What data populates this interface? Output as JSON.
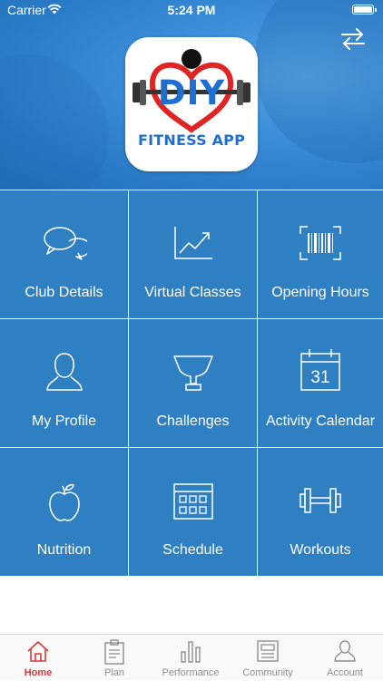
{
  "status_bar": {
    "carrier": "Carrier",
    "time": "5:24 PM"
  },
  "logo": {
    "title": "DIY",
    "subtitle": "FITNESS APP"
  },
  "colors": {
    "tile": "#2f7fc3",
    "active_tab": "#d63a3a",
    "inactive_tab": "#8e8e93",
    "header": "#3d8fd9"
  },
  "tiles": [
    {
      "label": "Club Details",
      "icon": "chat-bubbles-icon"
    },
    {
      "label": "Virtual Classes",
      "icon": "trend-chart-icon"
    },
    {
      "label": "Opening Hours",
      "icon": "barcode-scan-icon"
    },
    {
      "label": "My Profile",
      "icon": "person-icon"
    },
    {
      "label": "Challenges",
      "icon": "trophy-icon"
    },
    {
      "label": "Activity Calendar",
      "icon": "calendar-icon",
      "calendar_day": "31"
    },
    {
      "label": "Nutrition",
      "icon": "apple-icon"
    },
    {
      "label": "Schedule",
      "icon": "schedule-grid-icon"
    },
    {
      "label": "Workouts",
      "icon": "dumbbell-icon"
    }
  ],
  "tabs": [
    {
      "label": "Home",
      "icon": "home-icon",
      "active": true
    },
    {
      "label": "Plan",
      "icon": "clipboard-icon",
      "active": false
    },
    {
      "label": "Performance",
      "icon": "bar-chart-icon",
      "active": false
    },
    {
      "label": "Community",
      "icon": "community-board-icon",
      "active": false
    },
    {
      "label": "Account",
      "icon": "account-icon",
      "active": false
    }
  ]
}
